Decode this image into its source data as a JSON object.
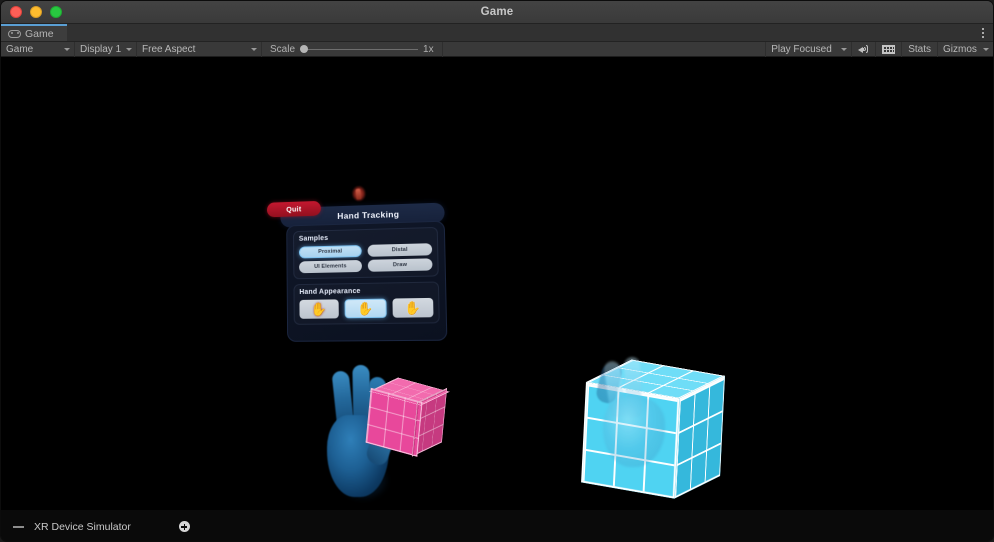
{
  "window": {
    "title": "Game",
    "traffic_lights": [
      "close",
      "minimize",
      "maximize"
    ],
    "colors": {
      "close": "#ff5f57",
      "minimize": "#febc2e",
      "maximize": "#28c840",
      "chrome": "#3b3b3b",
      "viewport_bg": "#000000",
      "tab_accent": "#5a9fd4"
    }
  },
  "tabstrip": {
    "tabs": [
      {
        "label": "Game",
        "icon": "gamepad-icon",
        "active": true
      }
    ],
    "overflow_menu_icon": "kebab-menu-icon"
  },
  "toolbar": {
    "view_dropdown": {
      "value": "Game",
      "icon": "chevron-down-icon"
    },
    "display_dropdown": {
      "value": "Display 1",
      "icon": "chevron-down-icon"
    },
    "aspect_dropdown": {
      "value": "Free Aspect",
      "icon": "chevron-down-icon"
    },
    "scale": {
      "label": "Scale",
      "value": "1x",
      "slider_position_pct": 0
    },
    "play_focused": {
      "value": "Play Focused",
      "icon": "chevron-down-icon"
    },
    "mute_audio_icon": "speaker-icon",
    "stats_grid_icon": "grid-icon",
    "stats_label": "Stats",
    "gizmos_label": "Gizmos",
    "gizmos_caret_icon": "chevron-down-icon"
  },
  "vr_panel": {
    "title": "Hand Tracking",
    "quit_label": "Quit",
    "floating_hand_icon": "hand-icon",
    "sections": [
      {
        "title": "Samples",
        "buttons": [
          {
            "label": "Proximal",
            "selected": true
          },
          {
            "label": "Distal",
            "selected": false
          },
          {
            "label": "UI Elements",
            "selected": false
          },
          {
            "label": "Draw",
            "selected": false
          }
        ]
      },
      {
        "title": "Hand Appearance",
        "thumbnails": [
          {
            "name": "hand-appearance-red",
            "glyph": "✋",
            "selected": false
          },
          {
            "name": "hand-appearance-blue-skeleton",
            "glyph": "✋",
            "selected": true
          },
          {
            "name": "hand-appearance-white",
            "glyph": "✋",
            "selected": false
          }
        ]
      }
    ]
  },
  "scene": {
    "blue_hand": {
      "name": "blue-tracked-hand",
      "gesture": "pinch"
    },
    "pink_cube": {
      "name": "pink-grid-cube",
      "color": "#e8489b"
    },
    "cyan_cube": {
      "name": "cyan-grid-cube",
      "color": "#4fd3f2"
    },
    "ghost_hand": {
      "name": "translucent-tracked-hand"
    }
  },
  "statusbar": {
    "handle_icon": "drag-handle-icon",
    "label": "XR Device Simulator",
    "add_icon": "plus-circle-icon"
  }
}
